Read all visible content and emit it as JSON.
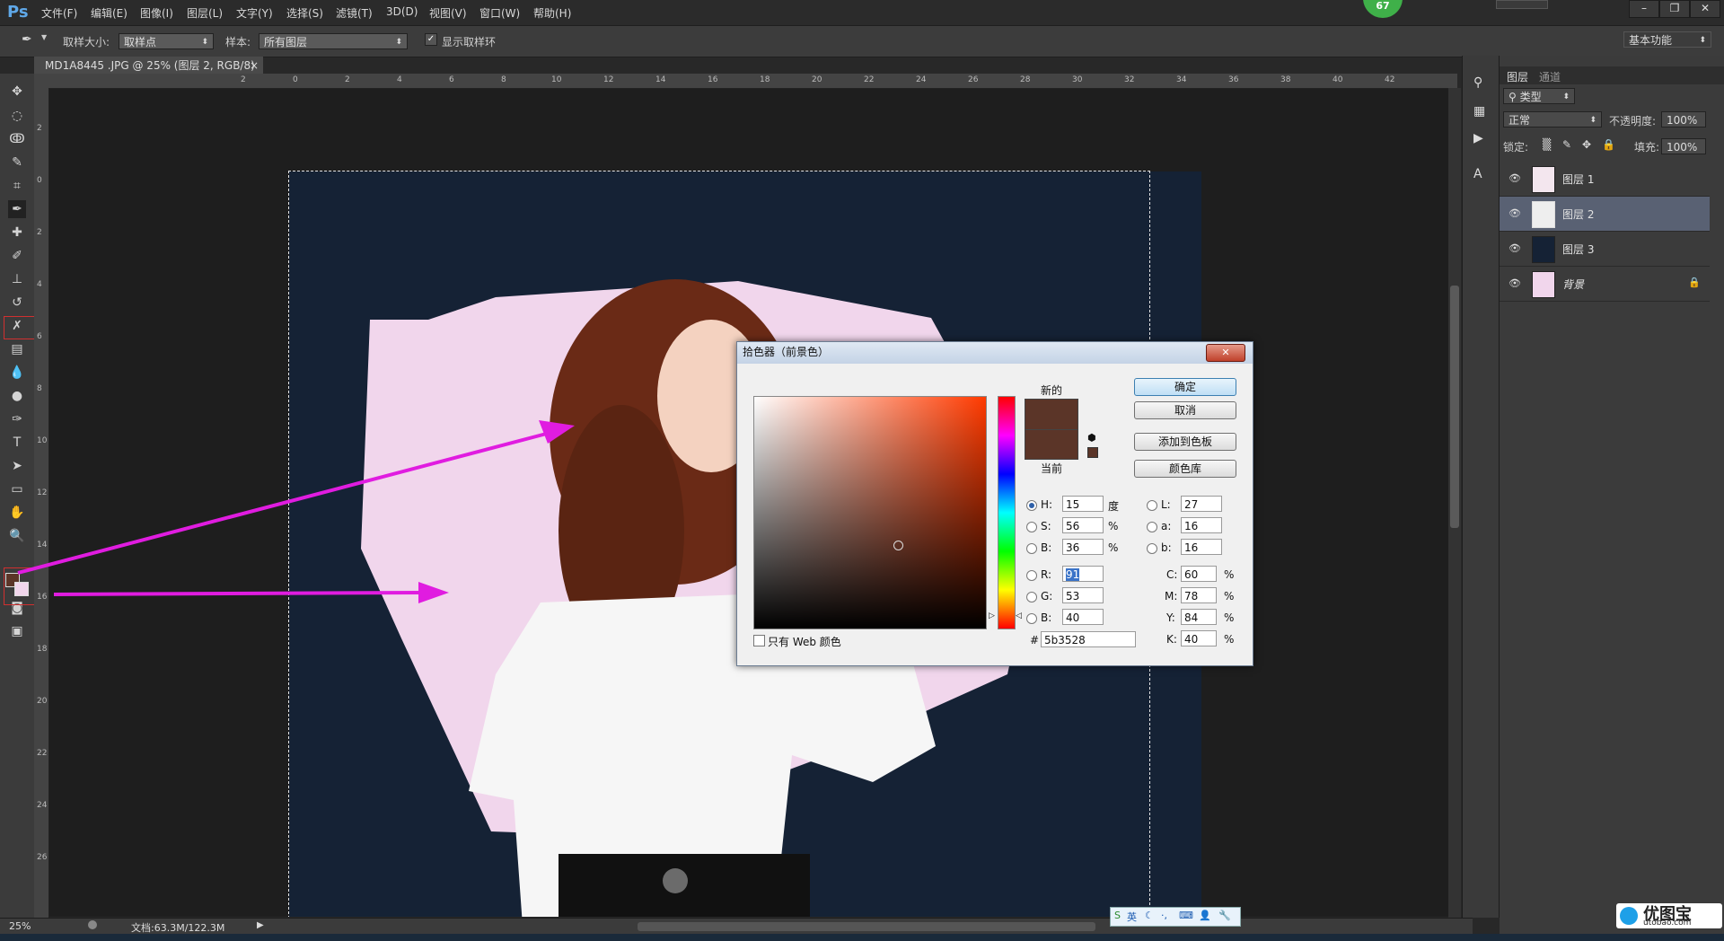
{
  "app": {
    "logo": "Ps",
    "badge": "67"
  },
  "menu": [
    "文件(F)",
    "编辑(E)",
    "图像(I)",
    "图层(L)",
    "文字(Y)",
    "选择(S)",
    "滤镜(T)",
    "3D(D)",
    "视图(V)",
    "窗口(W)",
    "帮助(H)"
  ],
  "options": {
    "sample_size_label": "取样大小:",
    "sample_size_value": "取样点",
    "sample_label": "样本:",
    "sample_value": "所有图层",
    "show_ring_label": "显示取样环",
    "workspace": "基本功能"
  },
  "document_tab": {
    "title": "MD1A8445 .JPG @ 25% (图层 2, RGB/8) *",
    "close": "×"
  },
  "ruler": {
    "top": [
      "2",
      "0",
      "2",
      "4",
      "6",
      "8",
      "10",
      "12",
      "14",
      "16",
      "18",
      "20",
      "22",
      "24",
      "26",
      "28",
      "30",
      "32",
      "34",
      "36",
      "38",
      "40",
      "42"
    ],
    "left": [
      "2",
      "0",
      "2",
      "4",
      "6",
      "8",
      "10",
      "12",
      "14",
      "16",
      "18",
      "20",
      "22",
      "24",
      "26"
    ]
  },
  "status": {
    "zoom": "25%",
    "doc": "文档:63.3M/122.3M"
  },
  "layers_panel": {
    "tabs": [
      "图层",
      "通道"
    ],
    "filter_type": "类型",
    "blend_mode": "正常",
    "opacity_label": "不透明度:",
    "opacity_value": "100%",
    "lock_label": "锁定:",
    "fill_label": "填充:",
    "fill_value": "100%",
    "layers": [
      {
        "name": "图层 1",
        "selected": false
      },
      {
        "name": "图层 2",
        "selected": true
      },
      {
        "name": "图层 3",
        "selected": false
      },
      {
        "name": "背景",
        "selected": false
      }
    ]
  },
  "color_picker": {
    "title": "拾色器（前景色）",
    "new_label": "新的",
    "current_label": "当前",
    "new_color": "#5b3528",
    "current_color": "#5b3528",
    "buttons": {
      "ok": "确定",
      "cancel": "取消",
      "add_swatch": "添加到色板",
      "libraries": "颜色库"
    },
    "hsb": {
      "H": "15",
      "S": "56",
      "B": "36",
      "h_unit": "度",
      "pct": "%"
    },
    "rgb": {
      "R": "91",
      "G": "53",
      "B": "40"
    },
    "lab": {
      "L": "27",
      "a": "16",
      "b": "16"
    },
    "cmyk": {
      "C": "60",
      "M": "78",
      "Y": "84",
      "K": "40"
    },
    "hex_label": "#",
    "hex": "5b3528",
    "web_only_label": "只有 Web 颜色",
    "field_labels": {
      "H": "H:",
      "S": "S:",
      "B": "B:",
      "R": "R:",
      "G": "G:",
      "B2": "B:",
      "L": "L:",
      "a": "a:",
      "b": "b:",
      "C": "C:",
      "M": "M:",
      "Y": "Y:",
      "K": "K:"
    }
  },
  "watermark": {
    "text": "优图宝",
    "url": "utobao.com"
  },
  "colors": {
    "arrow": "#e01ce0",
    "doc_bg": "#152235",
    "pink_shape": "#f1d6ec"
  }
}
